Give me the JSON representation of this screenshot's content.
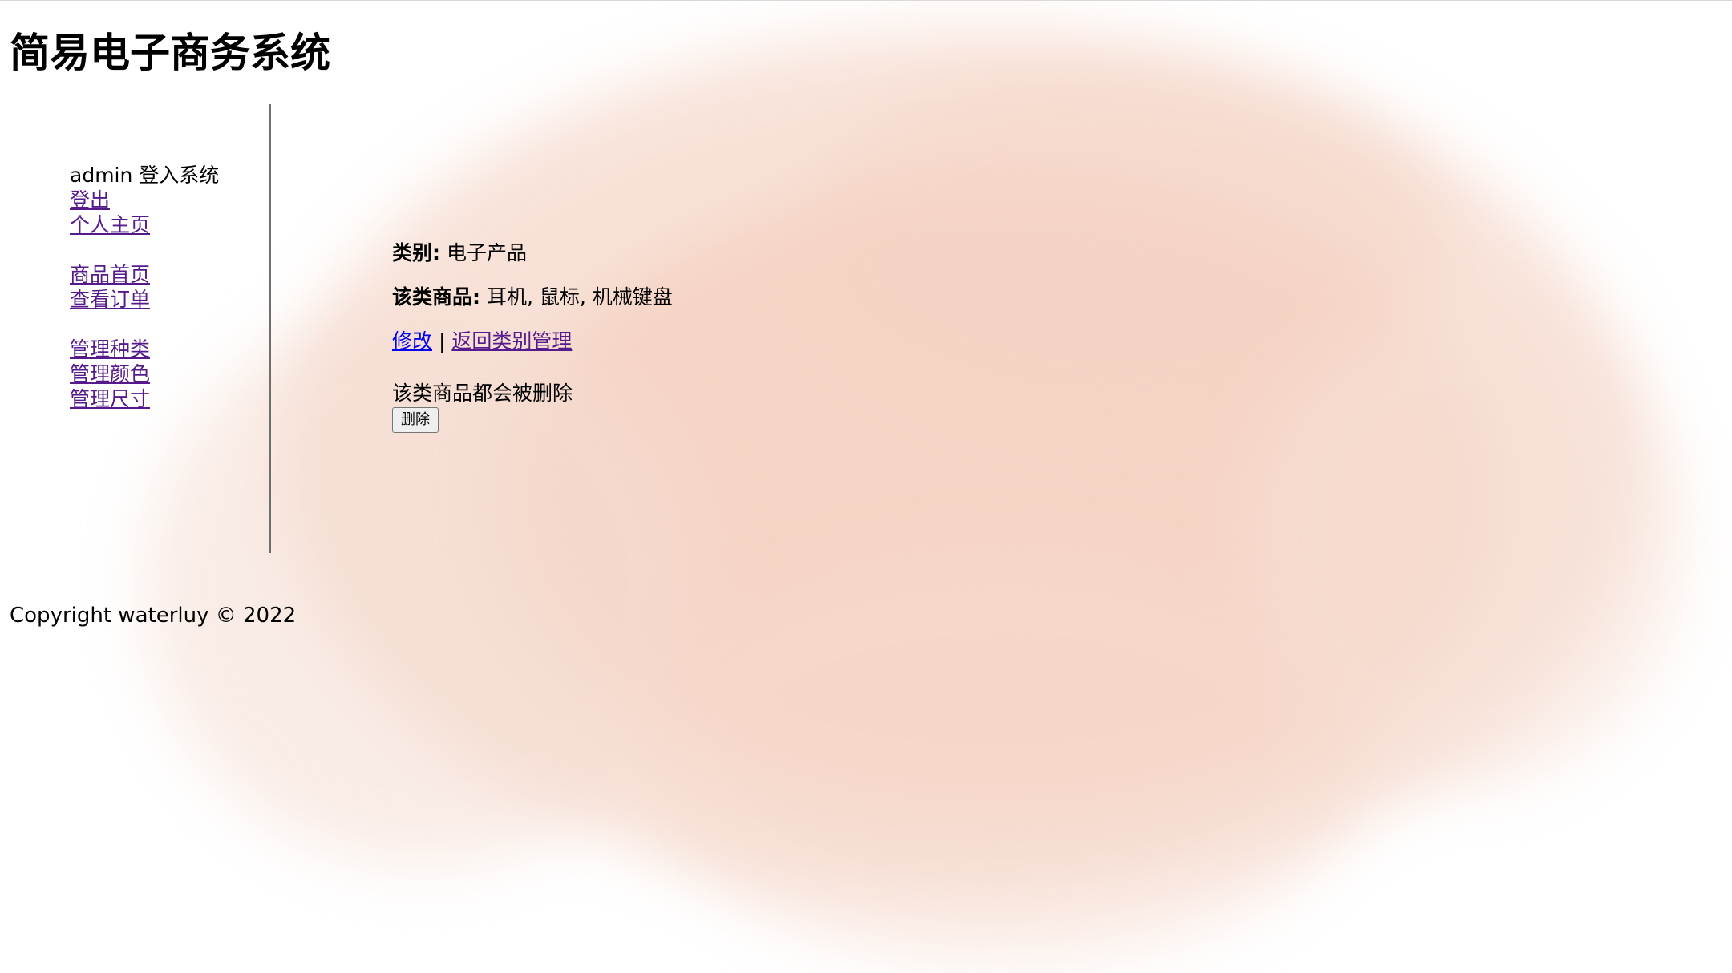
{
  "header": {
    "title": "简易电子商务系统"
  },
  "sidebar": {
    "user_text": "admin 登入系统",
    "links": {
      "logout": "登出",
      "profile": "个人主页",
      "products_home": "商品首页",
      "view_orders": "查看订单",
      "manage_categories": "管理种类",
      "manage_colors": "管理颜色",
      "manage_sizes": "管理尺寸"
    }
  },
  "main": {
    "category_label": "类别:",
    "category_value": "电子产品",
    "products_label": "该类商品:",
    "products_value": "耳机, 鼠标, 机械键盘",
    "edit_link": "修改",
    "separator": "|",
    "back_link": "返回类别管理",
    "delete_notice": "该类商品都会被删除",
    "delete_button": "删除"
  },
  "footer": {
    "copyright": "Copyright waterluy © 2022"
  },
  "colors": {
    "visited_link": "#551a8b",
    "link": "#0000ee",
    "background_wash": "#f3c9b6"
  }
}
